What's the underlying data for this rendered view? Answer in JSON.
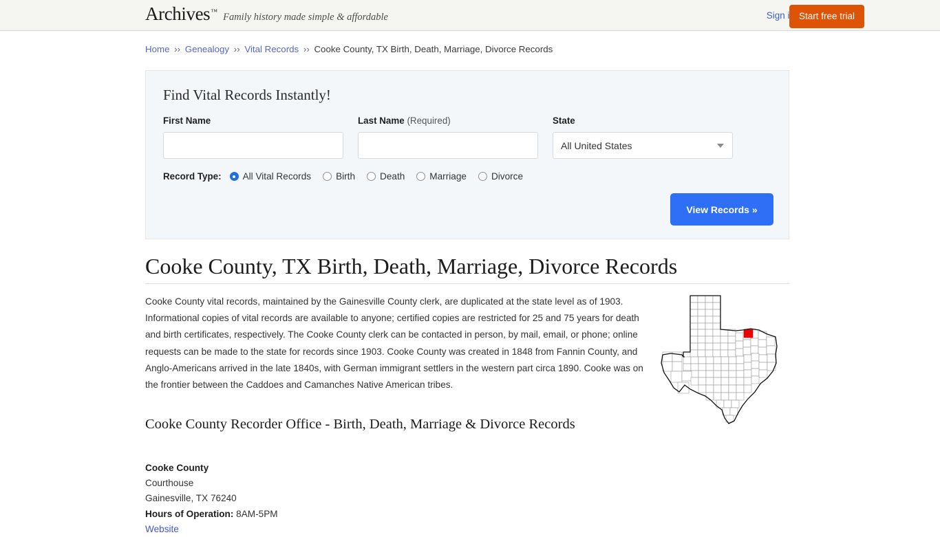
{
  "header": {
    "logo_text": "Archives",
    "logo_tm": "™",
    "tagline": "Family history made simple & affordable",
    "sign_in_label": "Sign in",
    "start_trial_label": "Start free trial",
    "brand_orange": "#dd5406",
    "background": "#f5f5f1"
  },
  "breadcrumb": {
    "separator": "››",
    "items": [
      {
        "label": "Home",
        "is_link": true
      },
      {
        "label": "Genealogy",
        "is_link": true
      },
      {
        "label": "Vital Records",
        "is_link": true
      },
      {
        "label": "Cooke County, TX Birth, Death, Marriage, Divorce Records",
        "is_link": false
      }
    ]
  },
  "search_form": {
    "title": "Find Vital Records Instantly!",
    "first_name": {
      "label": "First Name",
      "value": "",
      "placeholder": ""
    },
    "last_name": {
      "label": "Last Name",
      "required_note": "(Required)",
      "value": "",
      "placeholder": ""
    },
    "state": {
      "label": "State",
      "selected": "All United States"
    },
    "record_type": {
      "label": "Record Type:",
      "options": [
        {
          "label": "All Vital Records",
          "checked": true
        },
        {
          "label": "Birth",
          "checked": false
        },
        {
          "label": "Death",
          "checked": false
        },
        {
          "label": "Marriage",
          "checked": false
        },
        {
          "label": "Divorce",
          "checked": false
        }
      ]
    },
    "submit_label": "View Records »",
    "submit_color": "#2f6ff5",
    "panel_background": "#f4f7fa"
  },
  "main": {
    "page_title": "Cooke County, TX Birth, Death, Marriage, Divorce Records",
    "description": "Cooke County vital records, maintained by the Gainesville County clerk, are duplicated at the state level as of 1903. Informational copies of vital records are available to anyone; certified copies are restricted for 25 and 75 years for death and birth certificates, respectively. The Cooke County clerk can be contacted in person, by mail, email, or phone; online requests can be made to the state for records since 1903. Cooke County was created in 1848 from Fannin County, and Anglo-Americans arrived in the late 1840s, with German immigrant settlers in the western part circa 1890. Cooke was on the frontier between the Caddoes and Camanches Native American tribes.",
    "section_subtitle": "Cooke County Recorder Office - Birth, Death, Marriage & Divorce Records",
    "office": {
      "name": "Cooke County",
      "building": "Courthouse",
      "city_state_zip": "Gainesville, TX 76240",
      "hours_label": "Hours of Operation:",
      "hours_value": "8AM-5PM",
      "website_label": "Website"
    },
    "map": {
      "state": "Texas",
      "highlight_county": "Cooke County",
      "highlight_color": "#ee0000"
    }
  }
}
